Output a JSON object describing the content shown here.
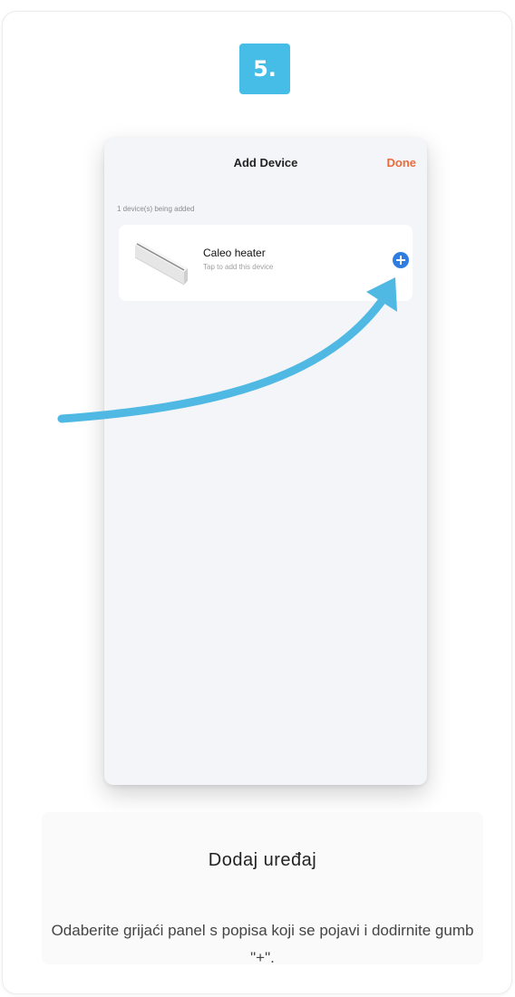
{
  "step": {
    "badge": "5."
  },
  "phone": {
    "title": "Add Device",
    "done_label": "Done",
    "devices_count": "1 device(s) being added",
    "device": {
      "name": "Caleo heater",
      "subtitle": "Tap to add this device"
    }
  },
  "caption": {
    "title": "Dodaj uređaj",
    "description": "Odaberite grijaći panel s popisa koji se pojavi i dodirnite gumb \"+\"."
  },
  "colors": {
    "badge": "#45bde6",
    "done": "#ef6a3a",
    "add_button": "#2f7de1",
    "arrow": "#4fb9e3"
  }
}
